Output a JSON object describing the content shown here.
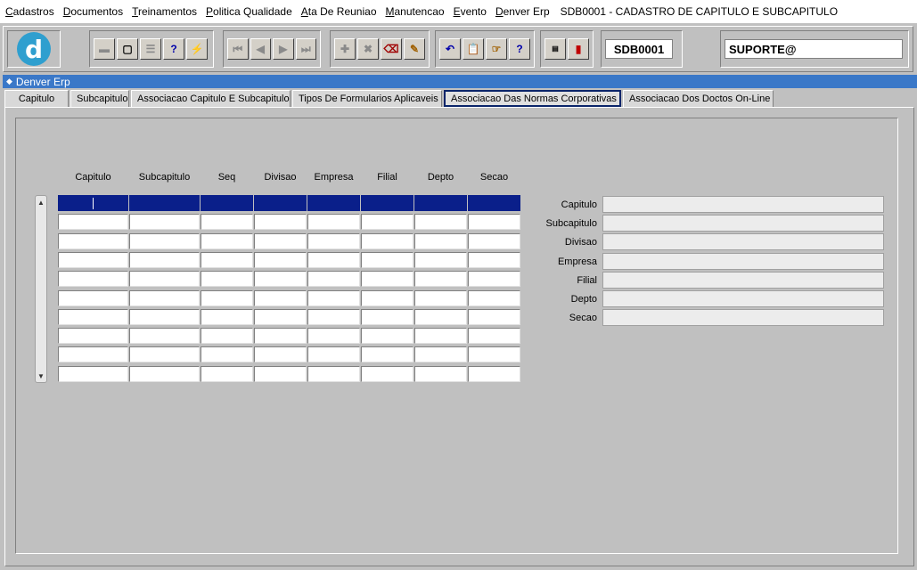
{
  "menu": {
    "items": [
      "Cadastros",
      "Documentos",
      "Treinamentos",
      "Politica Qualidade",
      "Ata De Reuniao",
      "Manutencao",
      "Evento",
      "Denver Erp"
    ],
    "title": "SDB0001 - CADASTRO DE CAPITULO E SUBCAPITULO"
  },
  "toolbar": {
    "logo_letter": "d",
    "form_code": "SDB0001",
    "user": "SUPORTE@",
    "icons": [
      "save-icon",
      "print-preview-icon",
      "print-icon",
      "query-help-icon",
      "execute-query-icon",
      "first-record-icon",
      "previous-record-icon",
      "next-record-icon",
      "last-record-icon",
      "insert-record-icon",
      "delete-record-icon",
      "clear-form-icon",
      "edit-icon",
      "undo-icon",
      "clipboard-icon",
      "list-values-icon",
      "help-icon",
      "menu-icon",
      "exit-icon"
    ]
  },
  "app": {
    "title": "Denver Erp"
  },
  "tabs": [
    {
      "label": "Capitulo"
    },
    {
      "label": "Subcapitulo"
    },
    {
      "label": "Associacao Capitulo E Subcapitulo"
    },
    {
      "label": "Tipos De Formularios Aplicaveis"
    },
    {
      "label": "Associacao Das Normas Corporativas"
    },
    {
      "label": "Associacao Dos Doctos On-Line"
    }
  ],
  "active_tab": "Associacao Das Normas Corporativas",
  "grid": {
    "columns": [
      "Capitulo",
      "Subcapitulo",
      "Seq",
      "Divisao",
      "Empresa",
      "Filial",
      "Depto",
      "Secao"
    ],
    "row_count": 10
  },
  "detail": {
    "labels": [
      "Capitulo",
      "Subcapitulo",
      "Divisao",
      "Empresa",
      "Filial",
      "Depto",
      "Secao"
    ]
  }
}
